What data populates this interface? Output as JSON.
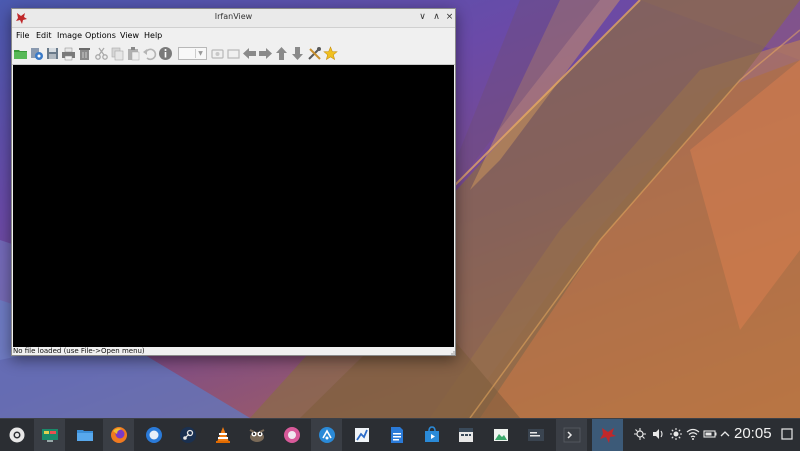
{
  "window": {
    "title": "IrfanView",
    "controls": {
      "minimize": "∨",
      "maximize": "∧",
      "close": "×"
    },
    "menu": [
      "File",
      "Edit",
      "Image",
      "Options",
      "View",
      "Help"
    ],
    "toolbar_icons": [
      "open-folder-icon",
      "thumbnails-icon",
      "save-icon",
      "print-icon",
      "delete-icon",
      "cut-icon",
      "copy-icon",
      "paste-icon",
      "undo-icon",
      "info-icon",
      "zoom-combo",
      "slideshow-icon",
      "fullscreen-icon",
      "previous-icon",
      "next-icon",
      "first-icon",
      "last-icon",
      "settings-icon",
      "favorite-icon"
    ],
    "status": "No file loaded (use File->Open menu)"
  },
  "taskbar": {
    "apps": [
      "application-launcher",
      "system-monitor",
      "file-manager",
      "firefox",
      "thunderbird",
      "steam",
      "vlc",
      "gimp",
      "podcast-app",
      "kde-connect",
      "krita",
      "libreoffice-writer",
      "store",
      "kalendar",
      "image-viewer",
      "terminal-settings",
      "konsole",
      "irfanview"
    ],
    "tray_icons": [
      "network-icon",
      "volume-icon",
      "brightness-icon",
      "wifi-icon",
      "battery-icon",
      "tray-expand-icon"
    ],
    "clock": "20:05"
  },
  "colors": {
    "taskbar_bg": "#2b2e33",
    "active_task": "#3c5a78",
    "window_bg": "#f0f0f0",
    "canvas": "#000000"
  }
}
